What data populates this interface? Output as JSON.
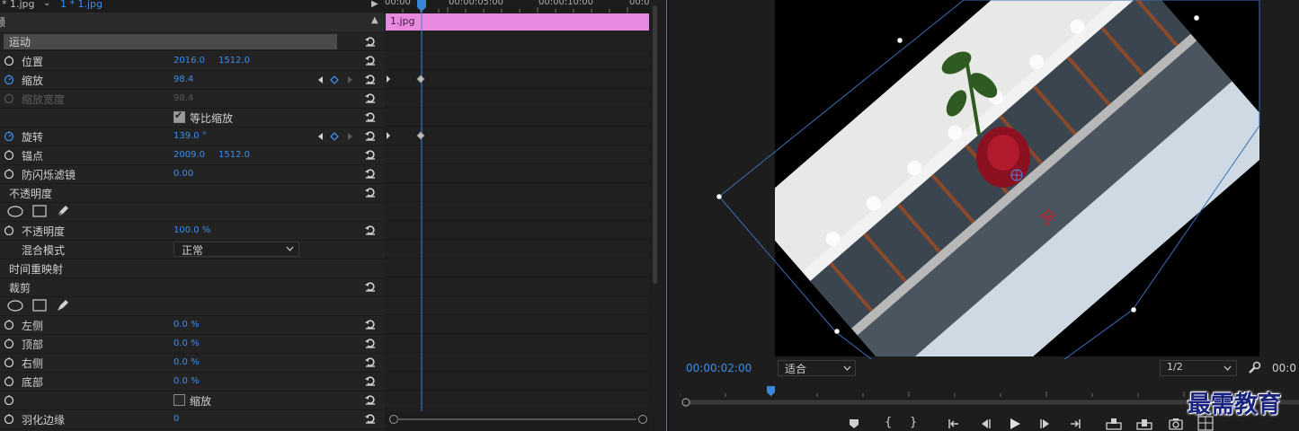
{
  "tabs": {
    "tab1": "* 1.jpg",
    "tab2": "1 * 1.jpg"
  },
  "header": {
    "partial": "频"
  },
  "sections": {
    "motion": "运动",
    "opacity": "不透明度",
    "time_remap": "时间重映射",
    "crop": "裁剪"
  },
  "motion": {
    "position": {
      "label": "位置",
      "x": "2016.0",
      "y": "1512.0"
    },
    "scale": {
      "label": "缩放",
      "value": "98.4"
    },
    "scale_width": {
      "label": "缩放宽度",
      "value": "98.4"
    },
    "uniform_scale": {
      "label": "等比缩放",
      "checked": true
    },
    "rotation": {
      "label": "旋转",
      "value": "139.0 °"
    },
    "anchor": {
      "label": "锚点",
      "x": "2009.0",
      "y": "1512.0"
    },
    "anti_flicker": {
      "label": "防闪烁滤镜",
      "value": "0.00"
    }
  },
  "opacity": {
    "value_label": "不透明度",
    "value": "100.0 %",
    "blend_label": "混合模式",
    "blend_value": "正常"
  },
  "crop": {
    "left": {
      "label": "左侧",
      "value": "0.0 %"
    },
    "top": {
      "label": "顶部",
      "value": "0.0 %"
    },
    "right": {
      "label": "右侧",
      "value": "0.0 %"
    },
    "bottom": {
      "label": "底部",
      "value": "0.0 %"
    },
    "zoom": {
      "label": "缩放",
      "checked": false
    },
    "feather": {
      "label": "羽化边缘",
      "value": "0"
    }
  },
  "timeline": {
    "ruler": [
      "00:00",
      "00:00:05:00",
      "00:00:10:00",
      "00:0"
    ],
    "clip_label": "1.jpg",
    "clip_color": "#e98ae0",
    "playhead_color": "#3a86d8"
  },
  "monitor": {
    "timecode": "00:00:02:00",
    "fit": "适合",
    "resolution": "1/2",
    "timecode_right": "00:0"
  },
  "watermark": "最需教育",
  "colors": {
    "accent": "#3d8ee6",
    "panel": "#232323"
  }
}
